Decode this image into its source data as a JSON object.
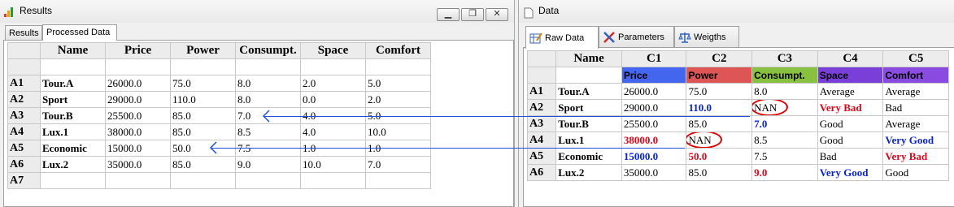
{
  "left_window": {
    "title": "Results",
    "tabs": [
      {
        "label": "Results"
      },
      {
        "label": "Processed Data"
      }
    ],
    "table": {
      "headers": [
        "Name",
        "Price",
        "Power",
        "Consumpt.",
        "Space",
        "Comfort"
      ],
      "rows": [
        {
          "id": "A1",
          "cells": [
            "Tour.A",
            "26000.0",
            "75.0",
            "8.0",
            "2.0",
            "5.0"
          ]
        },
        {
          "id": "A2",
          "cells": [
            "Sport",
            "29000.0",
            "110.0",
            "8.0",
            "0.0",
            "2.0"
          ]
        },
        {
          "id": "A3",
          "cells": [
            "Tour.B",
            "25500.0",
            "85.0",
            "7.0",
            "4.0",
            "5.0"
          ]
        },
        {
          "id": "A4",
          "cells": [
            "Lux.1",
            "38000.0",
            "85.0",
            "8.5",
            "4.0",
            "10.0"
          ]
        },
        {
          "id": "A5",
          "cells": [
            "Economic",
            "15000.0",
            "50.0",
            "7.5",
            "1.0",
            "1.0"
          ]
        },
        {
          "id": "A6",
          "cells": [
            "Lux.2",
            "35000.0",
            "85.0",
            "9.0",
            "10.0",
            "7.0"
          ]
        },
        {
          "id": "A7",
          "cells": [
            "",
            "",
            "",
            "",
            "",
            ""
          ]
        }
      ]
    }
  },
  "right_window": {
    "title": "Data",
    "tabs": [
      {
        "label": "Raw Data"
      },
      {
        "label": "Parameters"
      },
      {
        "label": "Weigths"
      }
    ],
    "table": {
      "headers": [
        "Name",
        "C1",
        "C2",
        "C3",
        "C4",
        "C5"
      ],
      "criteria": [
        "Price",
        "Power",
        "Consumpt.",
        "Space",
        "Comfort"
      ],
      "criteria_colors": [
        "#4466ee",
        "#dd5555",
        "#88c040",
        "#7a3fd8",
        "#8a4ce0"
      ],
      "rows": [
        {
          "id": "A1",
          "cells": [
            "Tour.A",
            "26000.0",
            "75.0",
            "8.0",
            "Average",
            "Average"
          ],
          "styles": [
            "",
            "",
            "",
            "",
            "",
            ""
          ]
        },
        {
          "id": "A2",
          "cells": [
            "Sport",
            "29000.0",
            "110.0",
            "NAN",
            "Very Bad",
            "Bad"
          ],
          "styles": [
            "",
            "",
            "blue",
            "circle",
            "red",
            ""
          ]
        },
        {
          "id": "A3",
          "cells": [
            "Tour.B",
            "25500.0",
            "85.0",
            "7.0",
            "Good",
            "Average"
          ],
          "styles": [
            "",
            "",
            "",
            "blue",
            "",
            ""
          ]
        },
        {
          "id": "A4",
          "cells": [
            "Lux.1",
            "38000.0",
            "NAN",
            "8.5",
            "Good",
            "Very Good"
          ],
          "styles": [
            "",
            "red",
            "circle",
            "",
            "",
            "blue"
          ]
        },
        {
          "id": "A5",
          "cells": [
            "Economic",
            "15000.0",
            "50.0",
            "7.5",
            "Bad",
            "Very Bad"
          ],
          "styles": [
            "",
            "blue",
            "red",
            "",
            "",
            "red"
          ]
        },
        {
          "id": "A6",
          "cells": [
            "Lux.2",
            "35000.0",
            "85.0",
            "9.0",
            "Very Good",
            "Good"
          ],
          "styles": [
            "",
            "",
            "",
            "red",
            "blue",
            ""
          ]
        }
      ]
    }
  },
  "colors": {
    "arrow": "#2050d8",
    "circle": "#e00000"
  },
  "icons": {
    "app": "bar-chart-icon",
    "doc": "document-icon",
    "raw": "table-edit-icon",
    "params": "tools-icon",
    "weights": "scale-icon"
  }
}
